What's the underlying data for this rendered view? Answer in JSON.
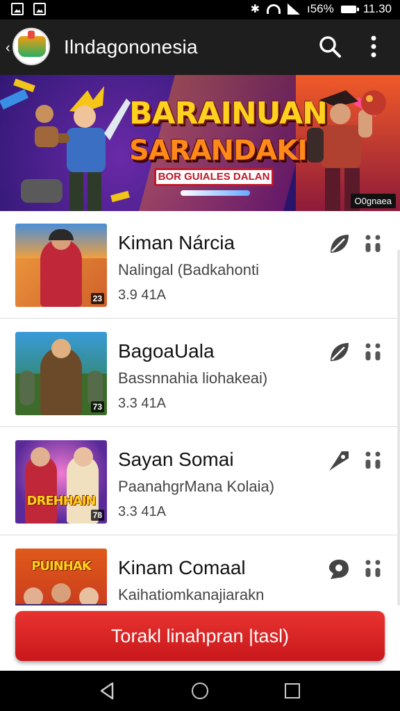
{
  "status_bar": {
    "battery_text": "ı56%",
    "time": "11.30",
    "icons": [
      "image-icon",
      "gallery-icon",
      "bluetooth-icon",
      "wifi-icon",
      "signal-icon",
      "battery-icon"
    ]
  },
  "app_bar": {
    "title": "Ilndagononesia",
    "icons": [
      "back-icon",
      "app-logo",
      "search-icon",
      "more-vert-icon"
    ]
  },
  "banner": {
    "title_line1": "BARAINUAN",
    "title_line2": "SARANDAKIM!",
    "ribbon": "BOR GUIALES DALAN",
    "badge": "O0gnaea"
  },
  "list": {
    "items": [
      {
        "title": "Kiman Nárcia",
        "subtitle": "Nalingal (Badkahonti",
        "meta": "3.9  41A",
        "thumb_badge": "23",
        "thumb_art": ""
      },
      {
        "title": "BagoaUala",
        "subtitle": "Bassnnahia liohakeai)",
        "meta": "3.3  41A",
        "thumb_badge": "73",
        "thumb_art": ""
      },
      {
        "title": "Sayan Somai",
        "subtitle": "PaanahgrMana Kolaia)",
        "meta": "3.3  41A",
        "thumb_badge": "78",
        "thumb_art": "DREHHAIN"
      },
      {
        "title": "Kinam Comaal",
        "subtitle": "Kaihatiomkanajiarakn",
        "meta": "",
        "thumb_badge": "",
        "thumb_art": "PUINHAK"
      }
    ]
  },
  "cta": {
    "label": "Torakl linahpran |tasl)"
  },
  "colors": {
    "app_bar": "#1e1e1e",
    "cta": "#d9221f",
    "banner_title": "#ffd21f"
  }
}
